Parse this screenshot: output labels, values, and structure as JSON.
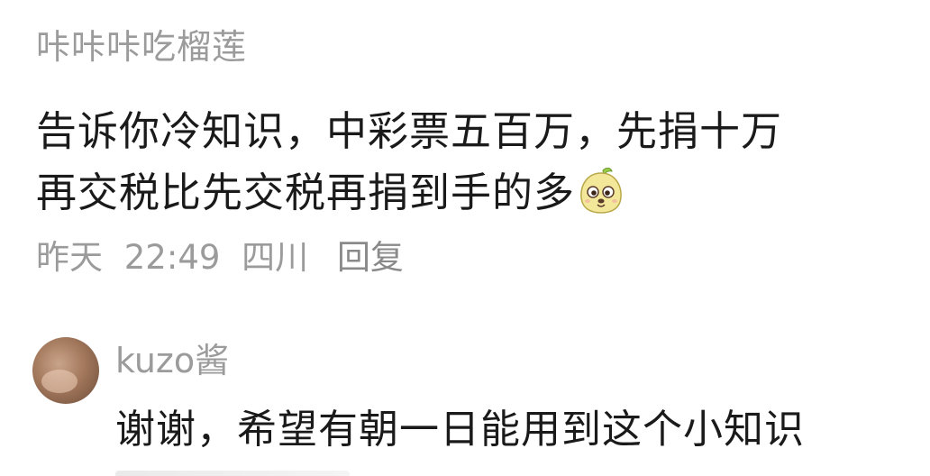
{
  "comment": {
    "username": "咔咔咔吃榴莲",
    "content_line1": "告诉你冷知识，中彩票五百万，先捐十万",
    "content_line2": "再交税比先交税再捐到手的多",
    "emoji_icon": "durian-face-emoji-icon",
    "meta": {
      "date": "昨天",
      "time": "22:49",
      "location": "四川",
      "reply_label": "回复"
    }
  },
  "reply": {
    "username": "kuzo酱",
    "content": "谢谢，希望有朝一日能用到这个小知识"
  },
  "colors": {
    "text_primary": "#1a1a1a",
    "text_secondary": "#9b9b9b",
    "emoji_fill": "#f3e79a",
    "emoji_leaf": "#9ccc4a"
  }
}
